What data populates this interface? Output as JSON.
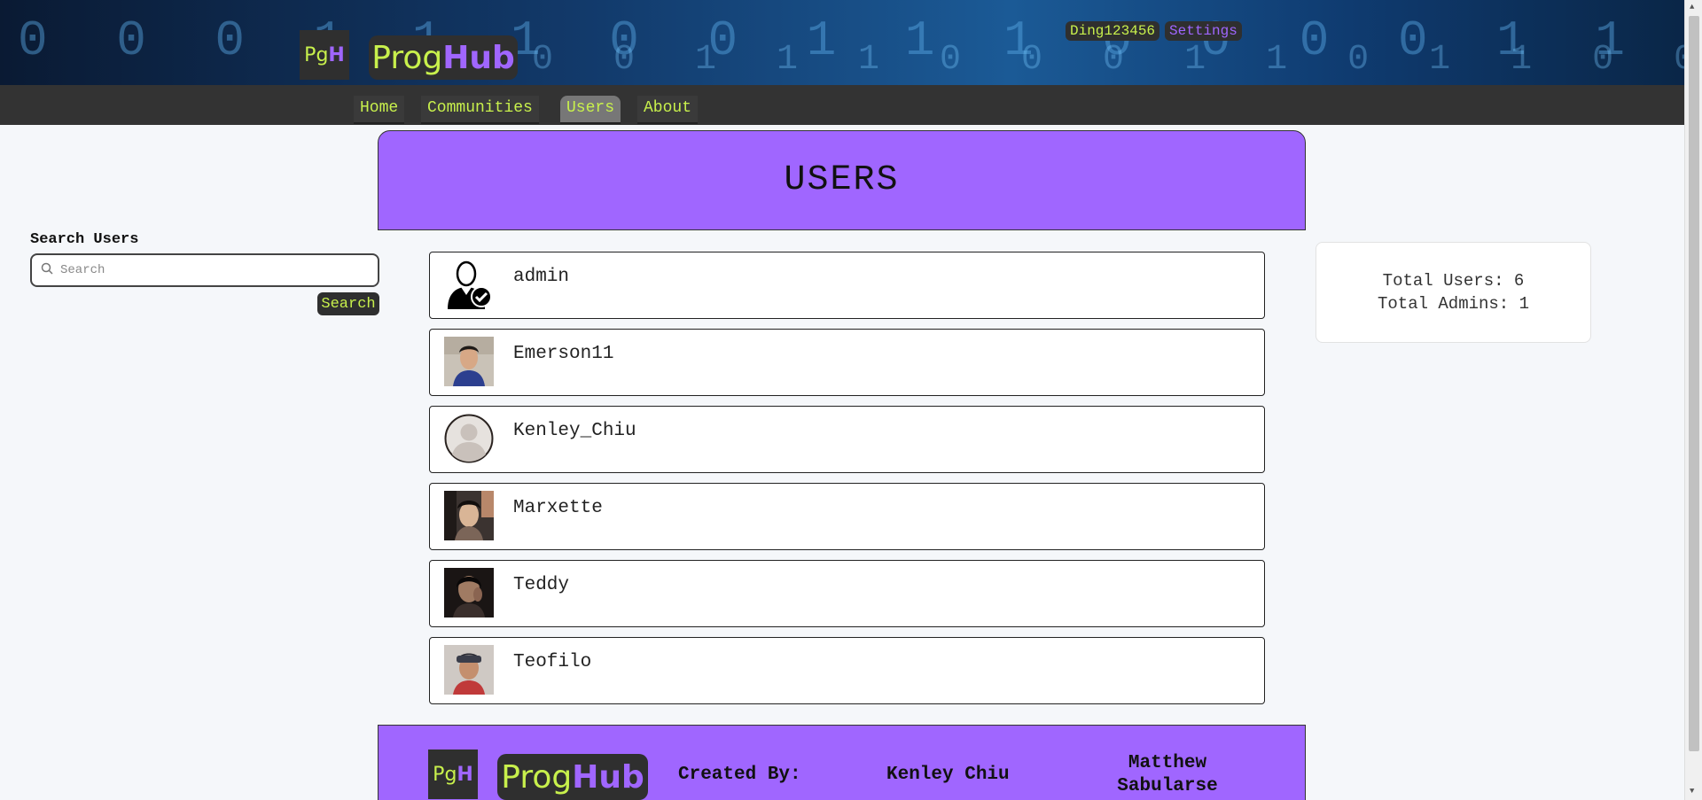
{
  "header": {
    "logo_mark_prefix": "Pg",
    "logo_mark_suffix": "H",
    "logo_word_prefix": "Prog",
    "logo_word_suffix": "Hub",
    "username": "Ding123456",
    "settings_label": "Settings"
  },
  "nav": {
    "items": [
      {
        "label": "Home"
      },
      {
        "label": "Communities"
      },
      {
        "label": "Users"
      },
      {
        "label": "About"
      }
    ],
    "active": "Users"
  },
  "page": {
    "title": "USERS"
  },
  "search": {
    "heading": "Search Users",
    "placeholder": "Search",
    "value": "",
    "button_label": "Search"
  },
  "users": [
    {
      "name": "admin",
      "avatar": "admin-verified-icon"
    },
    {
      "name": "Emerson11",
      "avatar": "photo"
    },
    {
      "name": "Kenley_Chiu",
      "avatar": "default-user-icon"
    },
    {
      "name": "Marxette",
      "avatar": "photo"
    },
    {
      "name": "Teddy",
      "avatar": "photo"
    },
    {
      "name": "Teofilo",
      "avatar": "photo"
    }
  ],
  "stats": {
    "total_users": "Total Users: 6",
    "total_admins": "Total Admins: 1"
  },
  "footer": {
    "created_by": "Created By:",
    "author1": "Kenley Chiu",
    "author2_line1": "Matthew",
    "author2_line2": "Sabularse"
  },
  "colors": {
    "accent_purple": "#a066ff",
    "accent_lime": "#c8f04c",
    "dark": "#2f2f2f",
    "nav_bg": "#333333"
  }
}
